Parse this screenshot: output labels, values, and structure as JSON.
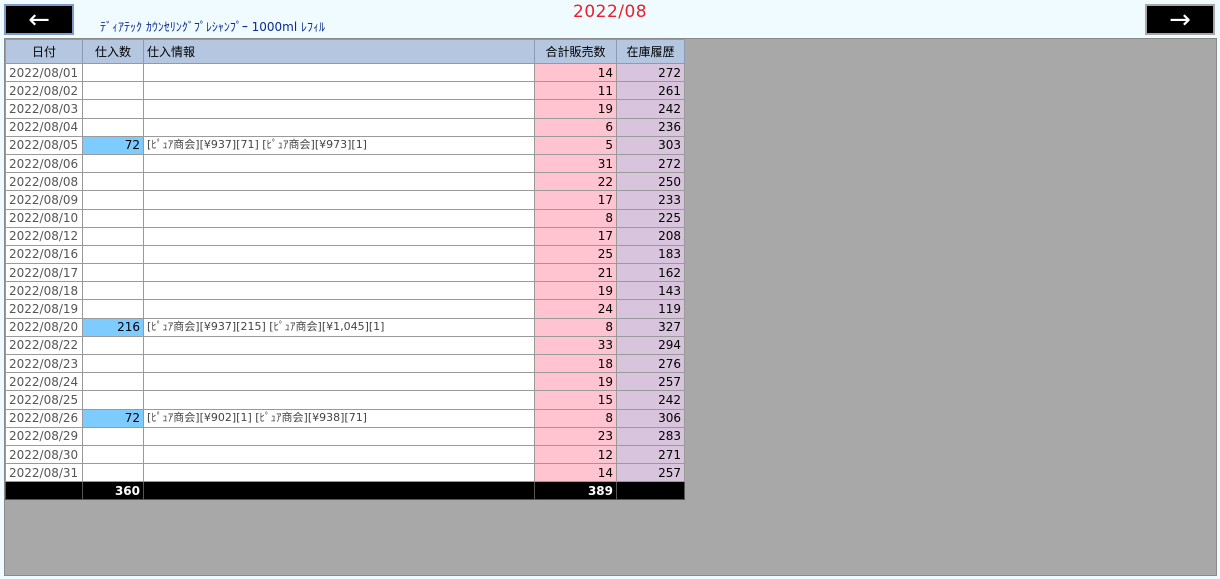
{
  "header": {
    "prev_icon": "←",
    "next_icon": "→",
    "product_title": "ﾃﾞｨｱﾃｯｸ ｶｳﾝｾﾘﾝｸﾞﾌﾟﾚｼｬﾝﾌﾟｰ 1000ml ﾚﾌｨﾙ",
    "month": "2022/08"
  },
  "table": {
    "columns": [
      "日付",
      "仕入数",
      "仕入情報",
      "合計販売数",
      "在庫履歴"
    ],
    "rows": [
      {
        "date": "2022/08/01",
        "qty": "",
        "info": "",
        "sales": "14",
        "stock": "272"
      },
      {
        "date": "2022/08/02",
        "qty": "",
        "info": "",
        "sales": "11",
        "stock": "261"
      },
      {
        "date": "2022/08/03",
        "qty": "",
        "info": "",
        "sales": "19",
        "stock": "242"
      },
      {
        "date": "2022/08/04",
        "qty": "",
        "info": "",
        "sales": "6",
        "stock": "236"
      },
      {
        "date": "2022/08/05",
        "qty": "72",
        "info": "[ﾋﾟｭｱ商会][¥937][71] [ﾋﾟｭｱ商会][¥973][1]",
        "sales": "5",
        "stock": "303"
      },
      {
        "date": "2022/08/06",
        "qty": "",
        "info": "",
        "sales": "31",
        "stock": "272"
      },
      {
        "date": "2022/08/08",
        "qty": "",
        "info": "",
        "sales": "22",
        "stock": "250"
      },
      {
        "date": "2022/08/09",
        "qty": "",
        "info": "",
        "sales": "17",
        "stock": "233"
      },
      {
        "date": "2022/08/10",
        "qty": "",
        "info": "",
        "sales": "8",
        "stock": "225"
      },
      {
        "date": "2022/08/12",
        "qty": "",
        "info": "",
        "sales": "17",
        "stock": "208"
      },
      {
        "date": "2022/08/16",
        "qty": "",
        "info": "",
        "sales": "25",
        "stock": "183"
      },
      {
        "date": "2022/08/17",
        "qty": "",
        "info": "",
        "sales": "21",
        "stock": "162"
      },
      {
        "date": "2022/08/18",
        "qty": "",
        "info": "",
        "sales": "19",
        "stock": "143"
      },
      {
        "date": "2022/08/19",
        "qty": "",
        "info": "",
        "sales": "24",
        "stock": "119"
      },
      {
        "date": "2022/08/20",
        "qty": "216",
        "info": "[ﾋﾟｭｱ商会][¥937][215] [ﾋﾟｭｱ商会][¥1,045][1]",
        "sales": "8",
        "stock": "327"
      },
      {
        "date": "2022/08/22",
        "qty": "",
        "info": "",
        "sales": "33",
        "stock": "294"
      },
      {
        "date": "2022/08/23",
        "qty": "",
        "info": "",
        "sales": "18",
        "stock": "276"
      },
      {
        "date": "2022/08/24",
        "qty": "",
        "info": "",
        "sales": "19",
        "stock": "257"
      },
      {
        "date": "2022/08/25",
        "qty": "",
        "info": "",
        "sales": "15",
        "stock": "242"
      },
      {
        "date": "2022/08/26",
        "qty": "72",
        "info": "[ﾋﾟｭｱ商会][¥902][1] [ﾋﾟｭｱ商会][¥938][71]",
        "sales": "8",
        "stock": "306"
      },
      {
        "date": "2022/08/29",
        "qty": "",
        "info": "",
        "sales": "23",
        "stock": "283"
      },
      {
        "date": "2022/08/30",
        "qty": "",
        "info": "",
        "sales": "12",
        "stock": "271"
      },
      {
        "date": "2022/08/31",
        "qty": "",
        "info": "",
        "sales": "14",
        "stock": "257"
      }
    ],
    "totals": {
      "qty": "360",
      "sales": "389"
    }
  }
}
